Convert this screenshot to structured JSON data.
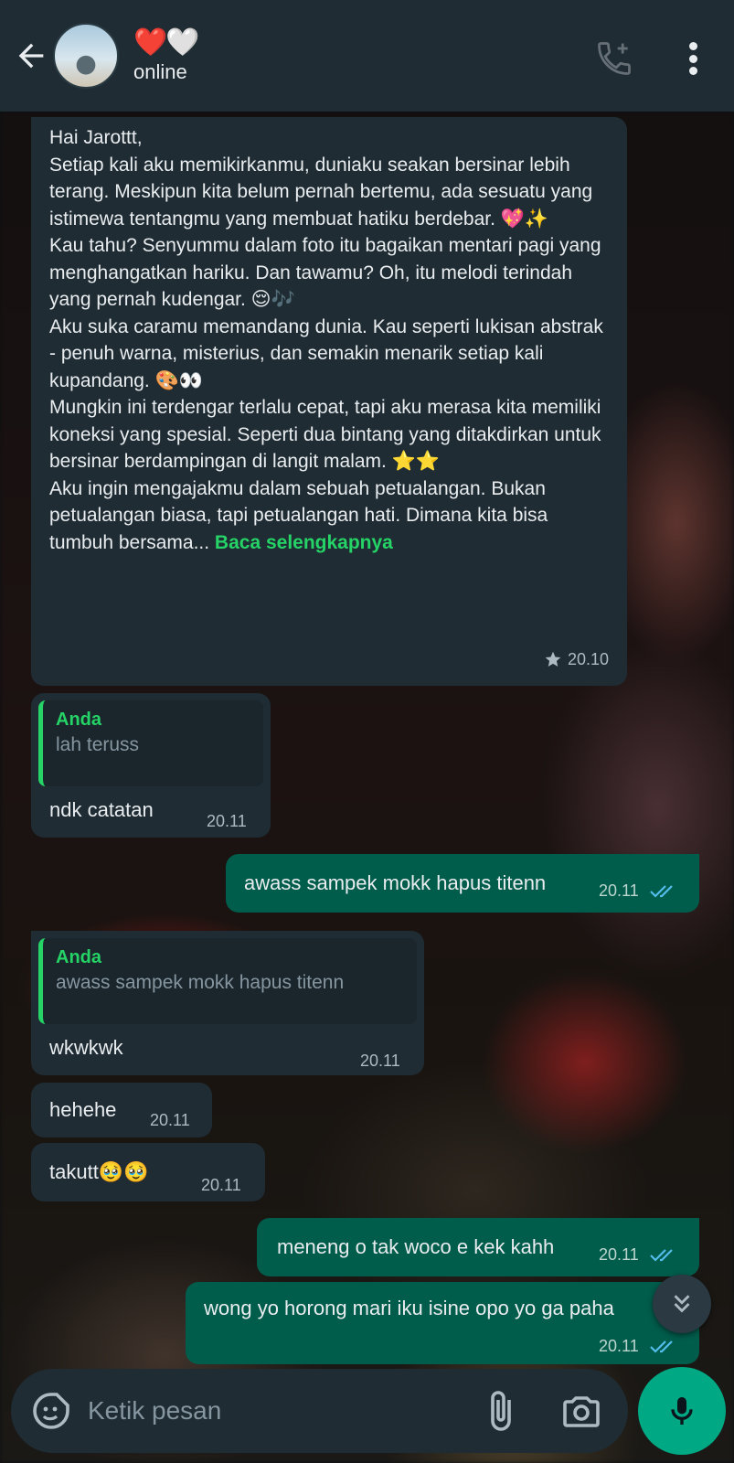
{
  "header": {
    "contact_name": "❤️🤍",
    "status": "online"
  },
  "messages": {
    "m1": {
      "text": "Hai Jarottt,\nSetiap kali aku memikirkanmu, duniaku seakan bersinar lebih terang. Meskipun kita belum pernah bertemu, ada sesuatu yang istimewa tentangmu yang membuat hatiku berdebar. 💖✨\nKau tahu? Senyummu dalam foto itu bagaikan mentari pagi yang menghangatkan hariku. Dan tawamu? Oh, itu melodi terindah yang pernah kudengar. 😌🎶\nAku suka caramu memandang dunia. Kau seperti lukisan abstrak - penuh warna, misterius, dan semakin menarik setiap kali kupandang. 🎨👀\nMungkin ini terdengar terlalu cepat, tapi aku merasa kita memiliki koneksi yang spesial. Seperti dua bintang yang ditakdirkan untuk bersinar berdampingan di langit malam. ⭐⭐\nAku ingin mengajakmu dalam sebuah petualangan. Bukan petualangan biasa, tapi petualangan hati. Dimana kita bisa tumbuh bersama... ",
      "read_more": "Baca selengkapnya",
      "time": "20.10",
      "starred": true
    },
    "m2": {
      "quote_author": "Anda",
      "quote_text": "lah teruss",
      "text": "ndk catatan",
      "time": "20.11"
    },
    "m3": {
      "text": "awass sampek mokk hapus titenn",
      "time": "20.11",
      "status": "read"
    },
    "m4": {
      "quote_author": "Anda",
      "quote_text": "awass sampek mokk hapus titenn",
      "text": "wkwkwk",
      "time": "20.11"
    },
    "m5": {
      "text": "hehehe",
      "time": "20.11"
    },
    "m6": {
      "text": "takutt🥹🥹",
      "time": "20.11"
    },
    "m7": {
      "text": "meneng o tak woco e kek kahh",
      "time": "20.11",
      "status": "read"
    },
    "m8": {
      "text": "wong yo horong mari iku isine opo yo ga paha",
      "time": "20.11",
      "status": "read"
    }
  },
  "input": {
    "placeholder": "Ketik pesan"
  },
  "icons": {
    "back": "arrow-left-icon",
    "add_call": "phone-plus-icon",
    "menu": "more-vertical-icon",
    "emoji": "sticker-icon",
    "attach": "paperclip-icon",
    "camera": "camera-icon",
    "mic": "mic-icon",
    "scroll": "double-chevron-down-icon",
    "star": "star-icon",
    "ticks": "double-check-icon"
  },
  "colors": {
    "header_bg": "#1f2c34",
    "incoming_bubble": "#1f2c34",
    "outgoing_bubble": "#005c4b",
    "accent_green": "#25d366",
    "read_tick": "#53bdeb",
    "mic_button": "#00a884"
  }
}
